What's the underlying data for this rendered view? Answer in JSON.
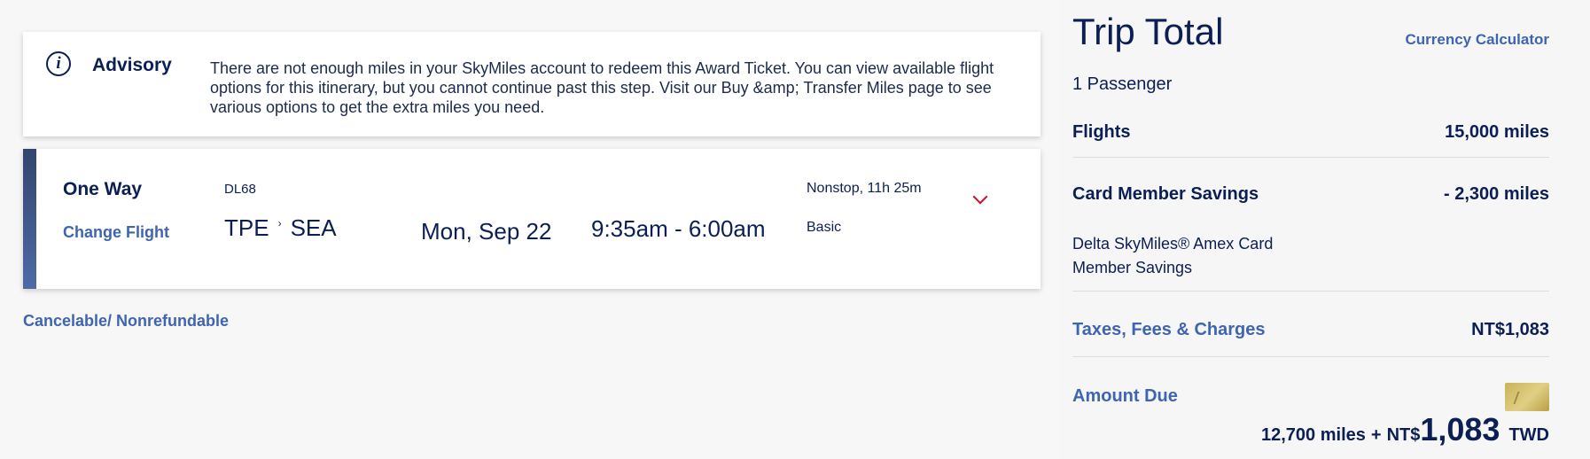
{
  "advisory": {
    "title": "Advisory",
    "message": "There are not enough miles in your SkyMiles account to redeem this Award Ticket. You can view available flight options for this itinerary, but you cannot continue past this step. Visit our Buy &amp; Transfer Miles page to see various options to get the extra miles you need."
  },
  "flight": {
    "trip_type": "One Way",
    "change_label": "Change Flight",
    "flight_number": "DL68",
    "origin": "TPE",
    "destination": "SEA",
    "route_arrow": "›",
    "date": "Mon, Sep 22",
    "times": "9:35am - 6:00am",
    "stops_duration": "Nonstop, 11h 25m",
    "fare_class": "Basic"
  },
  "policy": "Cancelable/ Nonrefundable",
  "summary": {
    "title": "Trip Total",
    "currency_calculator": "Currency Calculator",
    "passengers": "1 Passenger",
    "flights_label": "Flights",
    "flights_value": "15,000 miles",
    "savings_label": "Card Member Savings",
    "savings_value": "- 2,300 miles",
    "savings_desc_line1": "Delta SkyMiles® Amex Card",
    "savings_desc_line2": "Member Savings",
    "taxes_label": "Taxes, Fees & Charges",
    "taxes_value": "NT$1,083",
    "amount_due_label": "Amount Due",
    "amount_due_miles": "12,700 miles",
    "amount_due_plus": "+",
    "amount_due_currency_symbol": "NT$",
    "amount_due_amount": "1,083",
    "amount_due_currency_code": "TWD"
  },
  "colors": {
    "navy": "#0b1f54",
    "link_blue": "#3f64b0",
    "chevron_red": "#c8102e",
    "background": "#f6f6f7"
  },
  "icons": {
    "advisory": "info-icon",
    "expand": "chevron-down-icon",
    "card": "credit-card-icon"
  }
}
